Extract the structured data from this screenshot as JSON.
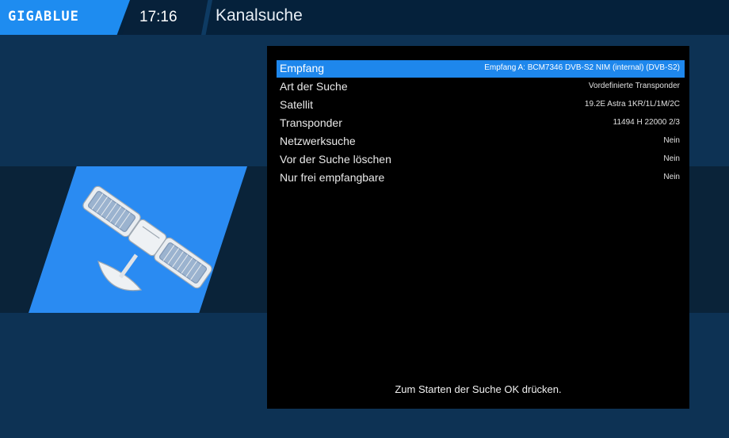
{
  "header": {
    "logo": "GIGABLUE",
    "clock": "17:16",
    "title": "Kanalsuche"
  },
  "icon": {
    "name": "satellite-icon"
  },
  "colors": {
    "background": "#0d3254",
    "accent": "#1e87ec",
    "panel": "#000000"
  },
  "settings": [
    {
      "label": "Empfang",
      "value": "Empfang A: BCM7346 DVB-S2 NIM (internal) (DVB-S2)",
      "selected": true
    },
    {
      "label": "Art der Suche",
      "value": "Vordefinierte Transponder",
      "selected": false
    },
    {
      "label": "Satellit",
      "value": "19.2E Astra 1KR/1L/1M/2C",
      "selected": false
    },
    {
      "label": "Transponder",
      "value": "11494 H 22000 2/3",
      "selected": false
    },
    {
      "label": "Netzwerksuche",
      "value": "Nein",
      "selected": false
    },
    {
      "label": "Vor der Suche löschen",
      "value": "Nein",
      "selected": false
    },
    {
      "label": "Nur frei empfangbare",
      "value": "Nein",
      "selected": false
    }
  ],
  "hint": "Zum Starten der Suche OK drücken."
}
